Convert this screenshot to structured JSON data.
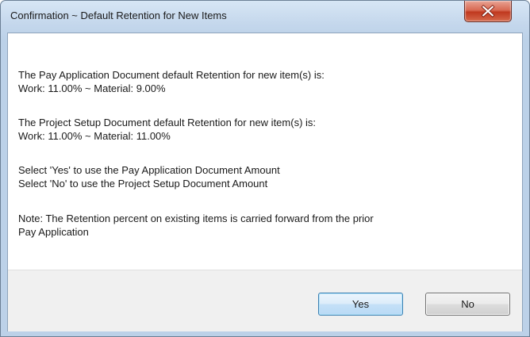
{
  "window": {
    "title": "Confirmation ~ Default Retention for New Items",
    "close_icon": "close-x-icon"
  },
  "message": {
    "lines": [
      "The Pay Application Document default Retention for new item(s) is:",
      "Work:  11.00% ~ Material:  9.00%",
      "The Project Setup Document default Retention for new item(s) is:",
      "Work:  11.00% ~ Material:  11.00%",
      "Select 'Yes' to use the Pay Application Document Amount",
      "Select 'No' to use the Project Setup Document Amount",
      "Note: The Retention percent on existing items is carried forward from the prior",
      "Pay Application"
    ]
  },
  "buttons": {
    "yes_label": "Yes",
    "no_label": "No"
  },
  "colors": {
    "close_button": "#c0391f",
    "default_button_border": "#3c7fb1",
    "button_bar_background": "#f0f0f0"
  }
}
